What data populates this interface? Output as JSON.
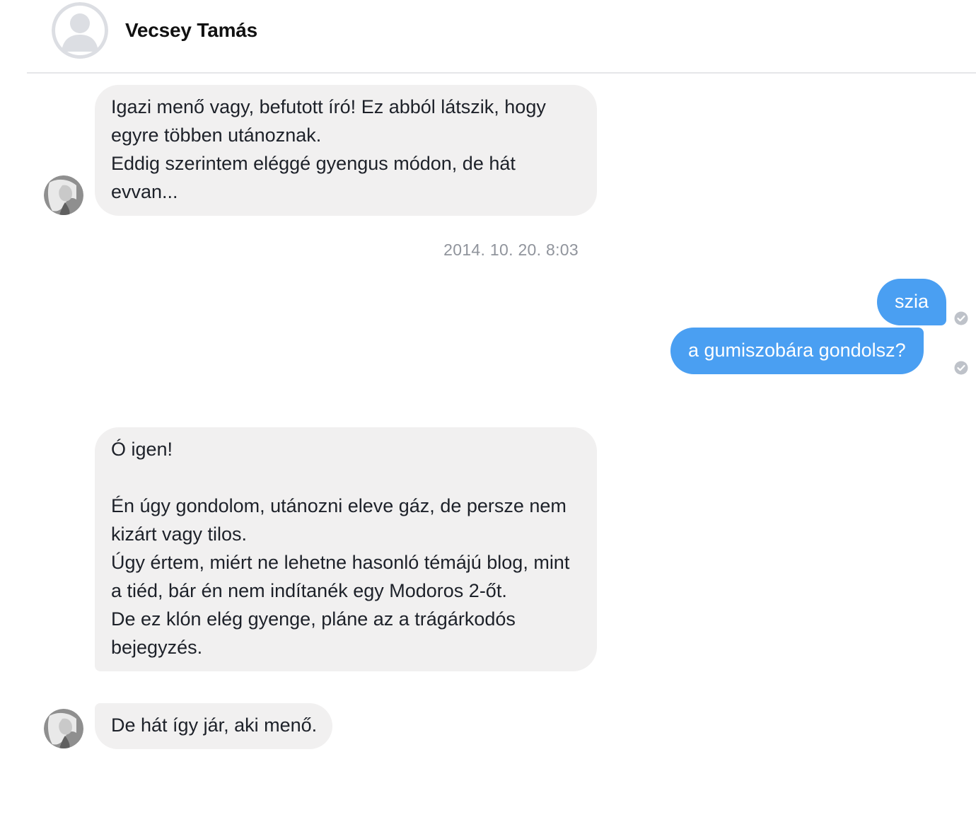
{
  "header": {
    "contact_name": "Vecsey Tamás",
    "avatar_icon": "default-profile-silhouette-icon"
  },
  "messages": [
    {
      "direction": "incoming",
      "text": "Igazi menő vagy, befutott író! Ez abból látszik, hogy egyre többen utánoznak.\nEddig szerintem eléggé gyengus módon, de hát evvan..."
    },
    {
      "direction": "outgoing",
      "text": "szia"
    },
    {
      "direction": "outgoing",
      "text": "a gumiszobára gondolsz?"
    },
    {
      "direction": "incoming",
      "text": "Ó igen!\n\nÉn úgy gondolom, utánozni eleve gáz, de persze nem kizárt vagy tilos.\nÚgy értem, miért ne lehetne hasonló témájú blog, mint a tiéd, bár én nem indítanék egy Modoros 2-őt.\nDe ez klón elég gyenge, pláne az a trágárkodós bejegyzés."
    },
    {
      "direction": "incoming",
      "text": "De hát így jár, aki menő."
    }
  ],
  "timestamp": "2014. 10. 20. 8:03",
  "colors": {
    "outgoing_bubble": "#4a9ff2",
    "incoming_bubble": "#f1f0f0",
    "timestamp_text": "#90949c",
    "divider": "#e5e6e9"
  }
}
